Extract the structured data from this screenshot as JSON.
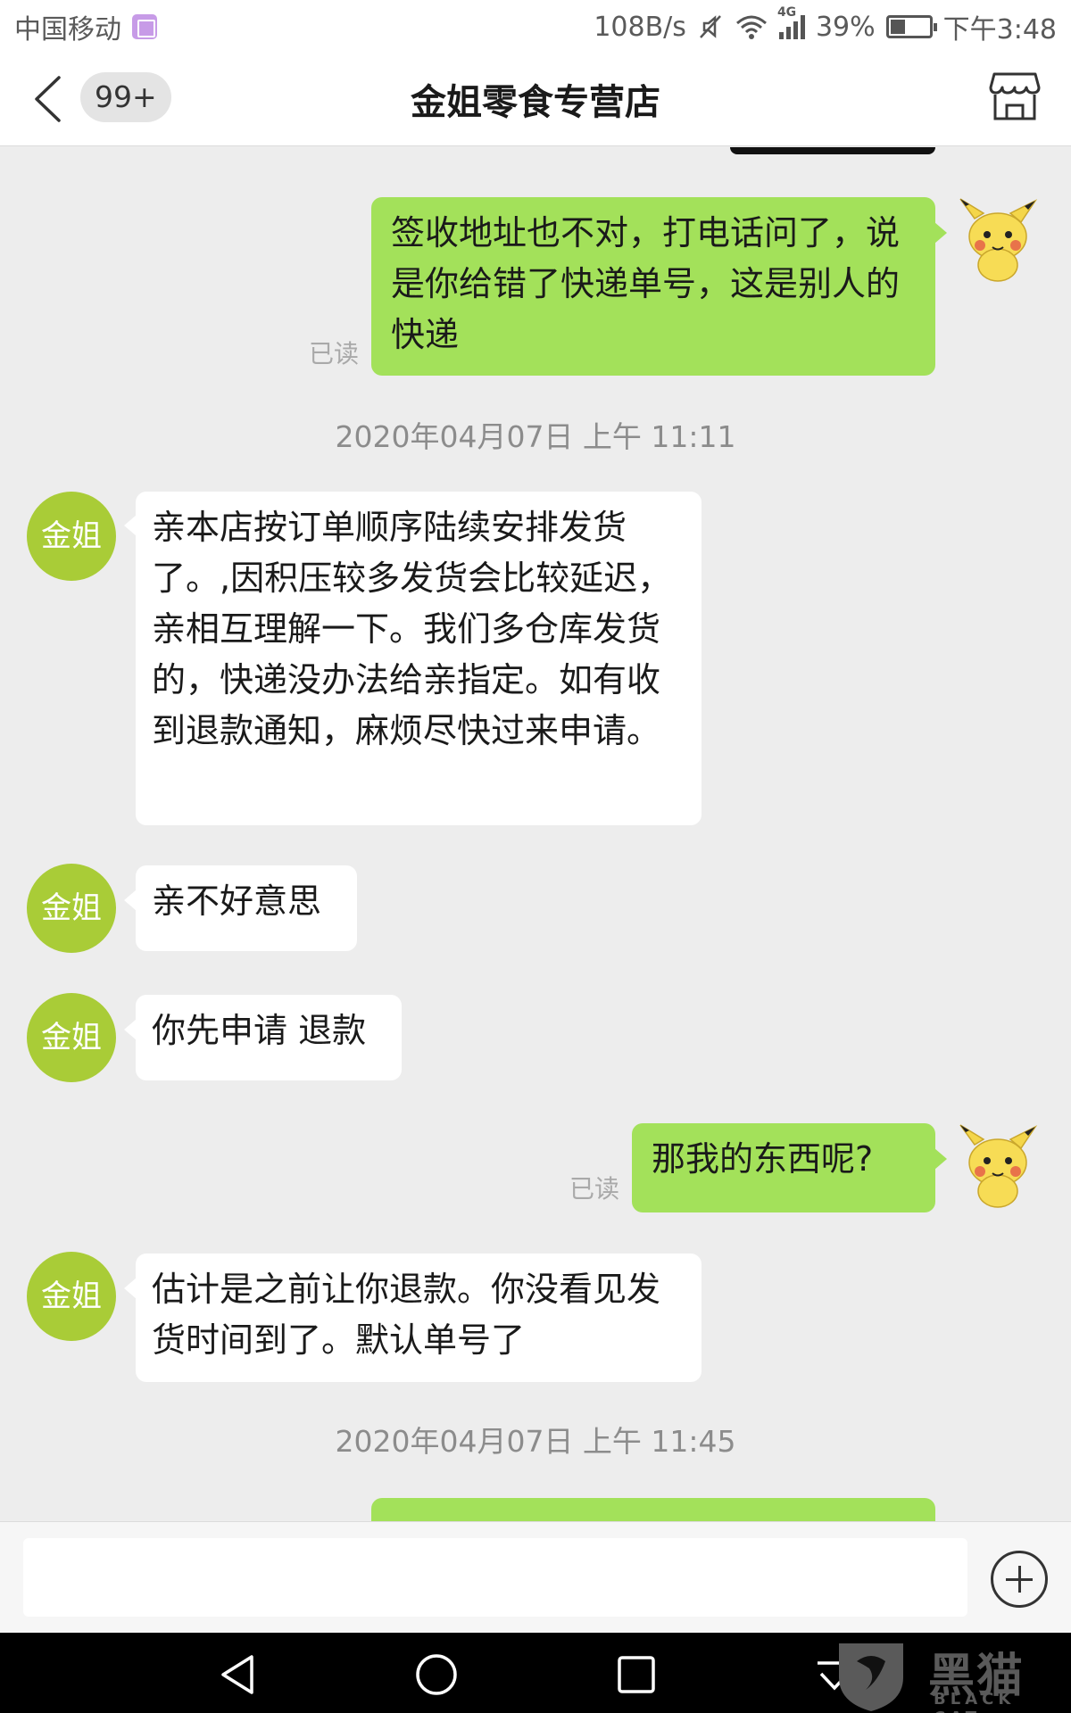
{
  "status_bar": {
    "carrier": "中国移动",
    "speed": "108B/s",
    "network": "4G",
    "battery": "39%",
    "time": "下午3:48"
  },
  "header": {
    "badge": "99+",
    "title": "金姐零食专营店"
  },
  "messages": [
    {
      "direction": "out",
      "text": "签收地址也不对，打电话问了，说是你给错了快递单号，这是别人的快递",
      "status": "已读"
    },
    {
      "type": "timestamp",
      "text": "2020年04月07日 上午 11:11"
    },
    {
      "direction": "in",
      "sender_avatar": "金姐",
      "text": "亲本店按订单顺序陆续安排发货了。,因积压较多发货会比较延迟，亲相互理解一下。我们多仓库发货的，快递没办法给亲指定。如有收到退款通知，麻烦尽快过来申请。"
    },
    {
      "direction": "in",
      "sender_avatar": "金姐",
      "text": "亲不好意思"
    },
    {
      "direction": "in",
      "sender_avatar": "金姐",
      "text": "你先申请 退款"
    },
    {
      "direction": "out",
      "text": "那我的东西呢?",
      "status": "已读"
    },
    {
      "direction": "in",
      "sender_avatar": "金姐",
      "text": "估计是之前让你退款。你没看见发货时间到了。默认单号了"
    },
    {
      "type": "timestamp",
      "text": "2020年04月07日 上午 11:45"
    }
  ],
  "input": {
    "placeholder": "",
    "value": ""
  },
  "watermark": {
    "text": "黑猫",
    "sub": "BLACK CAT"
  },
  "colors": {
    "outgoing_bubble": "#a3e15a",
    "incoming_bubble": "#ffffff",
    "avatar": "#a9cc37",
    "background": "#ededed"
  },
  "icons": [
    "back-arrow-icon",
    "store-icon",
    "add-circle-icon",
    "nav-back-icon",
    "nav-home-icon",
    "nav-recents-icon",
    "mute-icon",
    "wifi-icon",
    "signal-icon",
    "battery-icon"
  ]
}
